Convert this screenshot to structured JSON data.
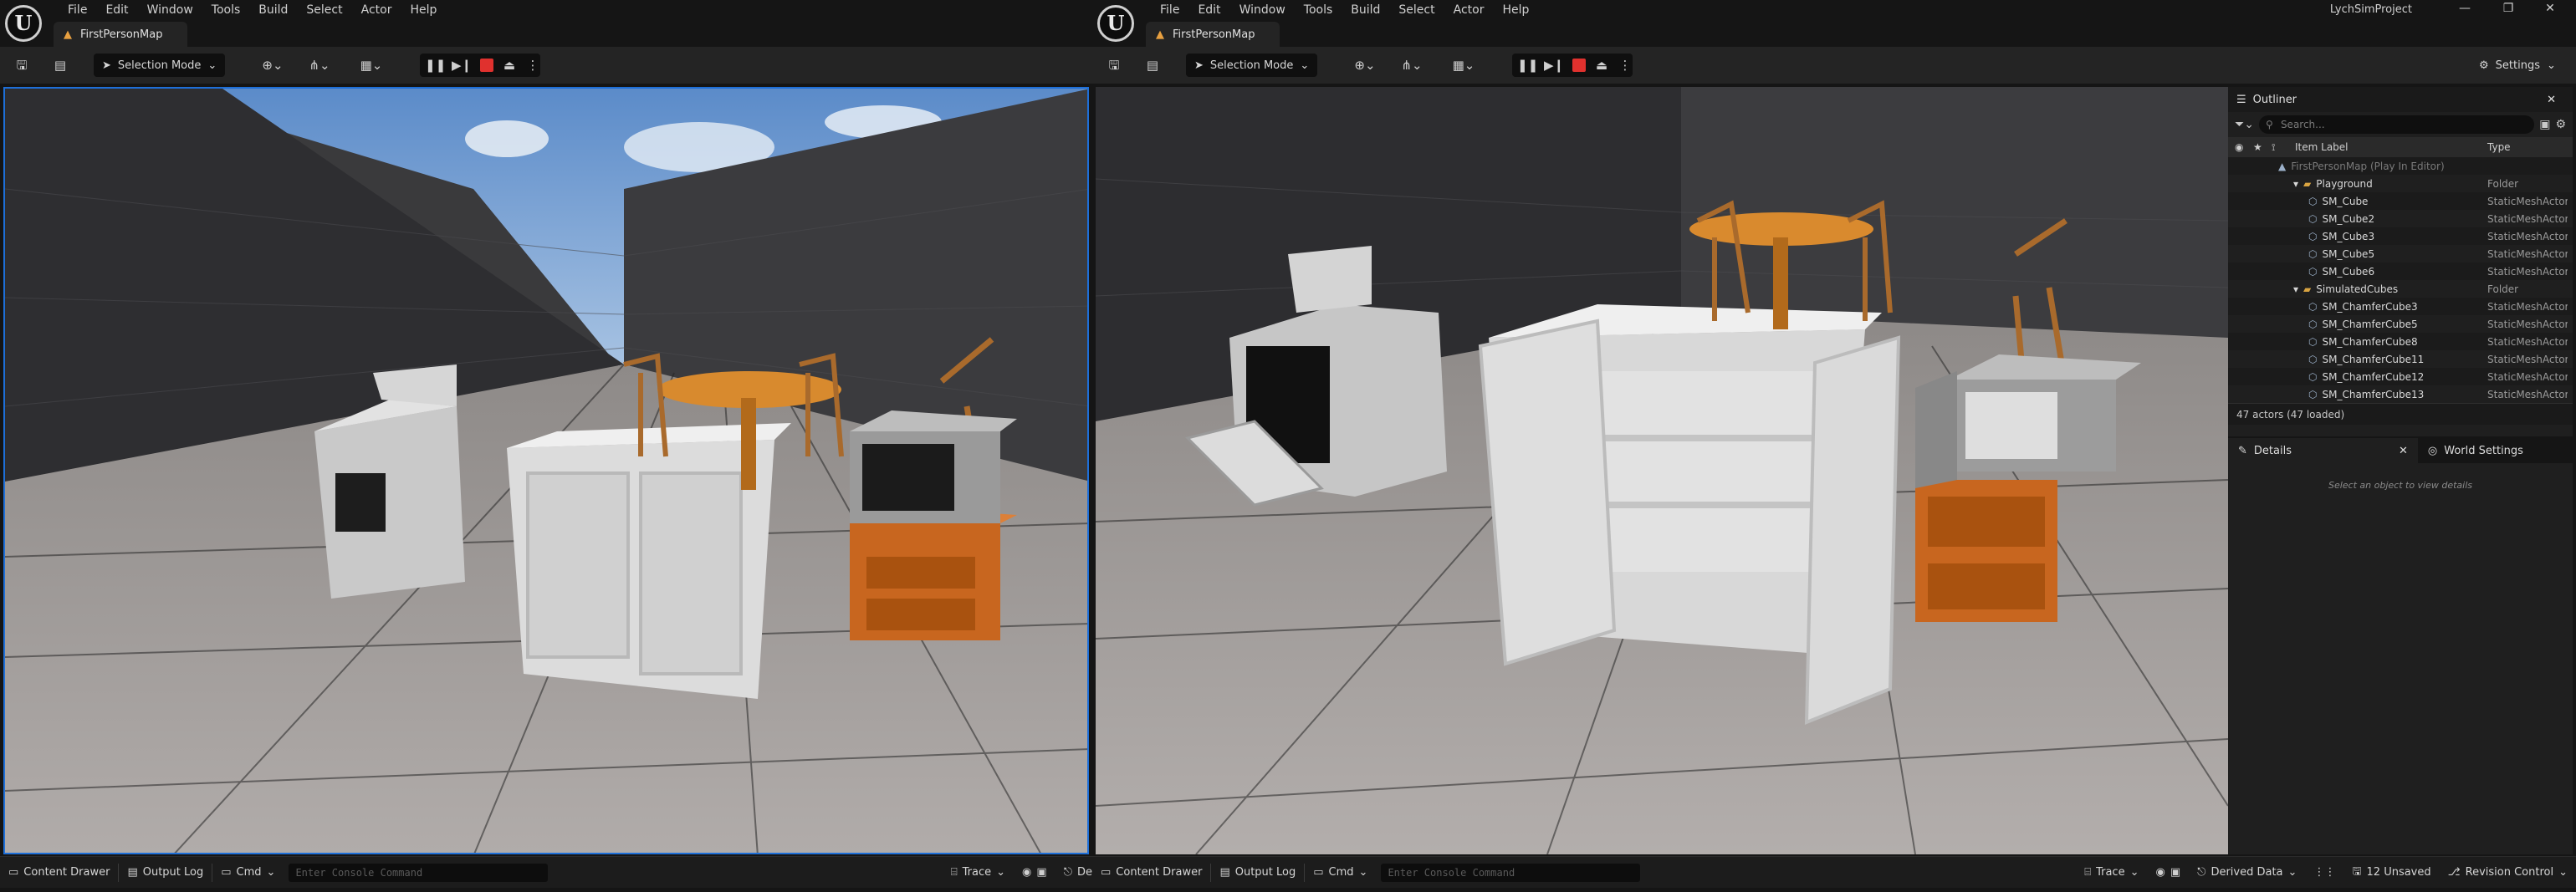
{
  "editorA": {
    "menu": [
      "File",
      "Edit",
      "Window",
      "Tools",
      "Build",
      "Select",
      "Actor",
      "Help"
    ],
    "tab": "FirstPersonMap",
    "mode_label": "Selection Mode",
    "status": {
      "content_drawer": "Content Drawer",
      "output_log": "Output Log",
      "cmd": "Cmd",
      "console_placeholder": "Enter Console Command",
      "trace": "Trace",
      "truncated": "De"
    }
  },
  "editorB": {
    "menu": [
      "File",
      "Edit",
      "Window",
      "Tools",
      "Build",
      "Select",
      "Actor",
      "Help"
    ],
    "tab": "FirstPersonMap",
    "mode_label": "Selection Mode",
    "project": "LychSimProject",
    "settings_label": "Settings",
    "status": {
      "content_drawer": "Content Drawer",
      "output_log": "Output Log",
      "cmd": "Cmd",
      "console_placeholder": "Enter Console Command",
      "trace": "Trace",
      "derived_data": "Derived Data",
      "unsaved": "12 Unsaved",
      "revision_control": "Revision Control"
    },
    "outliner": {
      "title": "Outliner",
      "search_placeholder": "Search...",
      "col_label": "Item Label",
      "col_type": "Type",
      "rows": [
        {
          "label": "FirstPersonMap (Play In Editor)",
          "type": "",
          "depth": 0,
          "kind": "map"
        },
        {
          "label": "Playground",
          "type": "Folder",
          "depth": 1,
          "kind": "folder"
        },
        {
          "label": "SM_Cube",
          "type": "StaticMeshActor",
          "depth": 2,
          "kind": "mesh"
        },
        {
          "label": "SM_Cube2",
          "type": "StaticMeshActor",
          "depth": 2,
          "kind": "mesh"
        },
        {
          "label": "SM_Cube3",
          "type": "StaticMeshActor",
          "depth": 2,
          "kind": "mesh"
        },
        {
          "label": "SM_Cube5",
          "type": "StaticMeshActor",
          "depth": 2,
          "kind": "mesh"
        },
        {
          "label": "SM_Cube6",
          "type": "StaticMeshActor",
          "depth": 2,
          "kind": "mesh"
        },
        {
          "label": "SimulatedCubes",
          "type": "Folder",
          "depth": 1,
          "kind": "folder"
        },
        {
          "label": "SM_ChamferCube3",
          "type": "StaticMeshActor",
          "depth": 2,
          "kind": "mesh"
        },
        {
          "label": "SM_ChamferCube5",
          "type": "StaticMeshActor",
          "depth": 2,
          "kind": "mesh"
        },
        {
          "label": "SM_ChamferCube8",
          "type": "StaticMeshActor",
          "depth": 2,
          "kind": "mesh"
        },
        {
          "label": "SM_ChamferCube11",
          "type": "StaticMeshActor",
          "depth": 2,
          "kind": "mesh"
        },
        {
          "label": "SM_ChamferCube12",
          "type": "StaticMeshActor",
          "depth": 2,
          "kind": "mesh"
        },
        {
          "label": "SM_ChamferCube13",
          "type": "StaticMeshActor",
          "depth": 2,
          "kind": "mesh"
        }
      ],
      "count": "47 actors (47 loaded)"
    },
    "details": {
      "tab_details": "Details",
      "tab_world": "World Settings",
      "empty": "Select an object to view details"
    }
  },
  "colors": {
    "accent_selection": "#1e6fd8",
    "stop_button": "#e0312e",
    "folder": "#d9a441",
    "orange_furniture": "#c8661f"
  }
}
